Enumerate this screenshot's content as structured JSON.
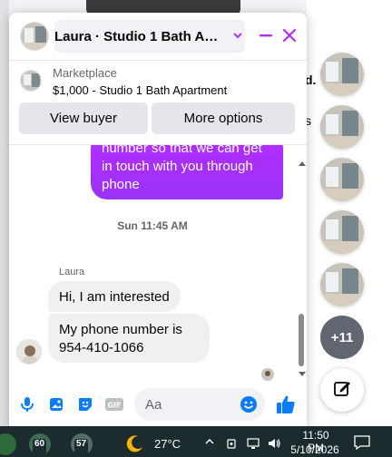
{
  "chat": {
    "header_title": "Laura · Studio 1 Bath Apart…",
    "listing_source": "Marketplace",
    "listing_title": "$1,000 - Studio 1 Bath Apartment",
    "view_buyer_label": "View buyer",
    "more_options_label": "More options",
    "outgoing_message_visible": "number so that we can get in touch with you through phone",
    "time_separator": "Sun 11:45 AM",
    "sender_name": "Laura",
    "incoming_messages": [
      "Hi, I am interested",
      "My phone number is 954-410-1066"
    ],
    "composer_placeholder": "Aa"
  },
  "right_column": {
    "more_heads_label": "+11",
    "partial_text_1": "d.",
    "partial_text_2": "s"
  },
  "taskbar": {
    "badge_1": "60",
    "badge_2": "57",
    "temperature": "27°C",
    "time": "11:50 PM",
    "date": "5/10/2026"
  },
  "colors": {
    "accent_purple": "#a033ff",
    "messenger_blue": "#0a7cff",
    "header_icons": "#b42cff",
    "taskbar_bg": "#1c2b2e"
  },
  "icons": [
    "dropdown-chevron-icon",
    "minimize-icon",
    "close-icon",
    "mic-icon",
    "photo-icon",
    "sticker-icon",
    "gif-icon",
    "emoji-icon",
    "like-icon",
    "compose-icon",
    "weather-moon-icon",
    "wifi-icon",
    "volume-icon",
    "notification-icon"
  ]
}
